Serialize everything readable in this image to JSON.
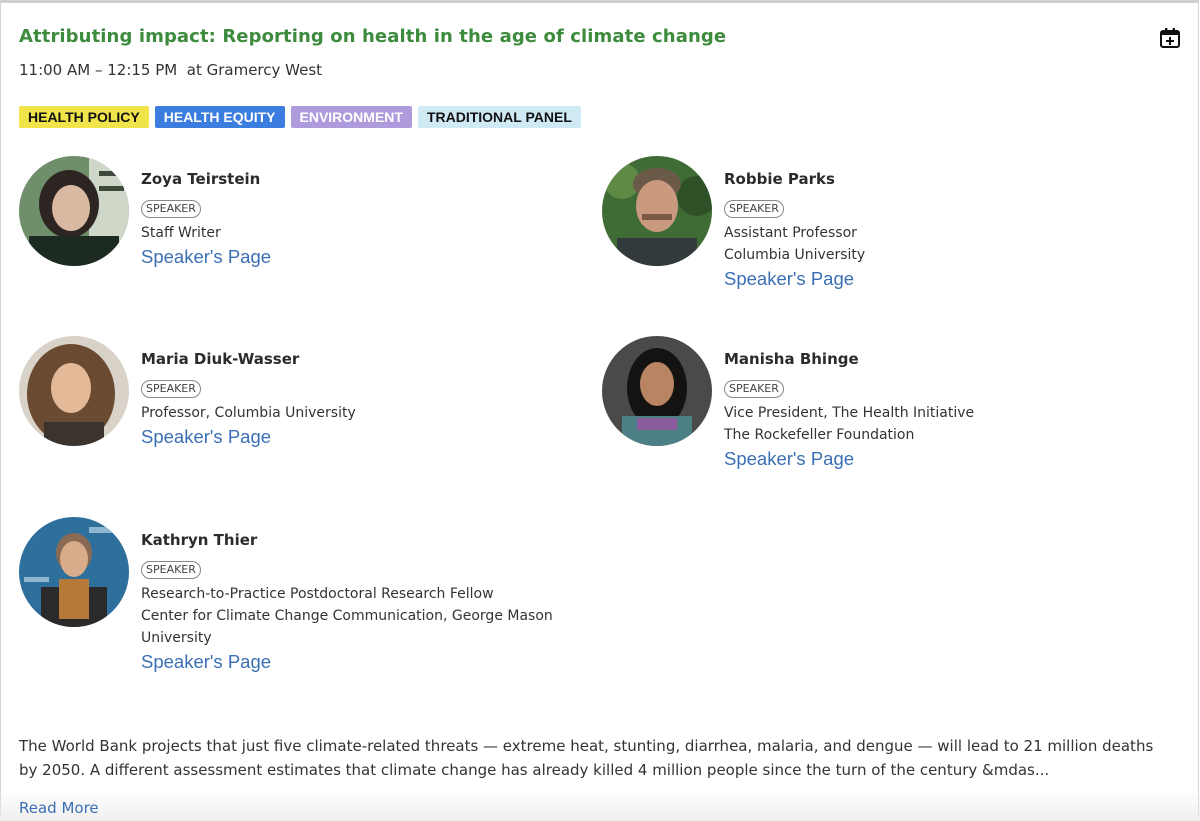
{
  "session": {
    "title": "Attributing impact: Reporting on health in the age of climate change",
    "time": "11:00 AM – 12:15 PM",
    "location": "at Gramercy West",
    "calendar_icon": "calendar-plus-icon"
  },
  "tags": [
    {
      "label": "HEALTH POLICY",
      "bg": "#f1e34a",
      "color": "#111111"
    },
    {
      "label": "HEALTH EQUITY",
      "bg": "#3b7dde",
      "color": "#ffffff"
    },
    {
      "label": "ENVIRONMENT",
      "bg": "#ad9bdc",
      "color": "#ffffff"
    },
    {
      "label": "TRADITIONAL PANEL",
      "bg": "#cfe9f5",
      "color": "#111111"
    }
  ],
  "speakers": [
    {
      "name": "Zoya Teirstein",
      "badge": "SPEAKER",
      "role": [
        "Staff Writer"
      ],
      "link": "Speaker's Page"
    },
    {
      "name": "Robbie Parks",
      "badge": "SPEAKER",
      "role": [
        "Assistant Professor",
        "Columbia University"
      ],
      "link": "Speaker's Page"
    },
    {
      "name": "Maria Diuk-Wasser",
      "badge": "SPEAKER",
      "role": [
        "Professor, Columbia University"
      ],
      "link": "Speaker's Page"
    },
    {
      "name": "Manisha Bhinge",
      "badge": "SPEAKER",
      "role": [
        "Vice President, The Health Initiative",
        "The Rockefeller Foundation"
      ],
      "link": "Speaker's Page"
    },
    {
      "name": "Kathryn Thier",
      "badge": "SPEAKER",
      "role": [
        "Research-to-Practice Postdoctoral Research Fellow",
        "Center for Climate Change Communication, George Mason",
        "University"
      ],
      "link": "Speaker's Page"
    }
  ],
  "description": "The World Bank projects that just five climate-related threats — extreme heat, stunting, diarrhea, malaria, and dengue — will lead to 21 million deaths by 2050. A different assessment estimates that climate change has already killed 4 million people since the turn of the century &mdas...",
  "read_more": "Read More",
  "colors": {
    "title_green": "#3d8b3d",
    "link_blue": "#3a6fb5"
  }
}
